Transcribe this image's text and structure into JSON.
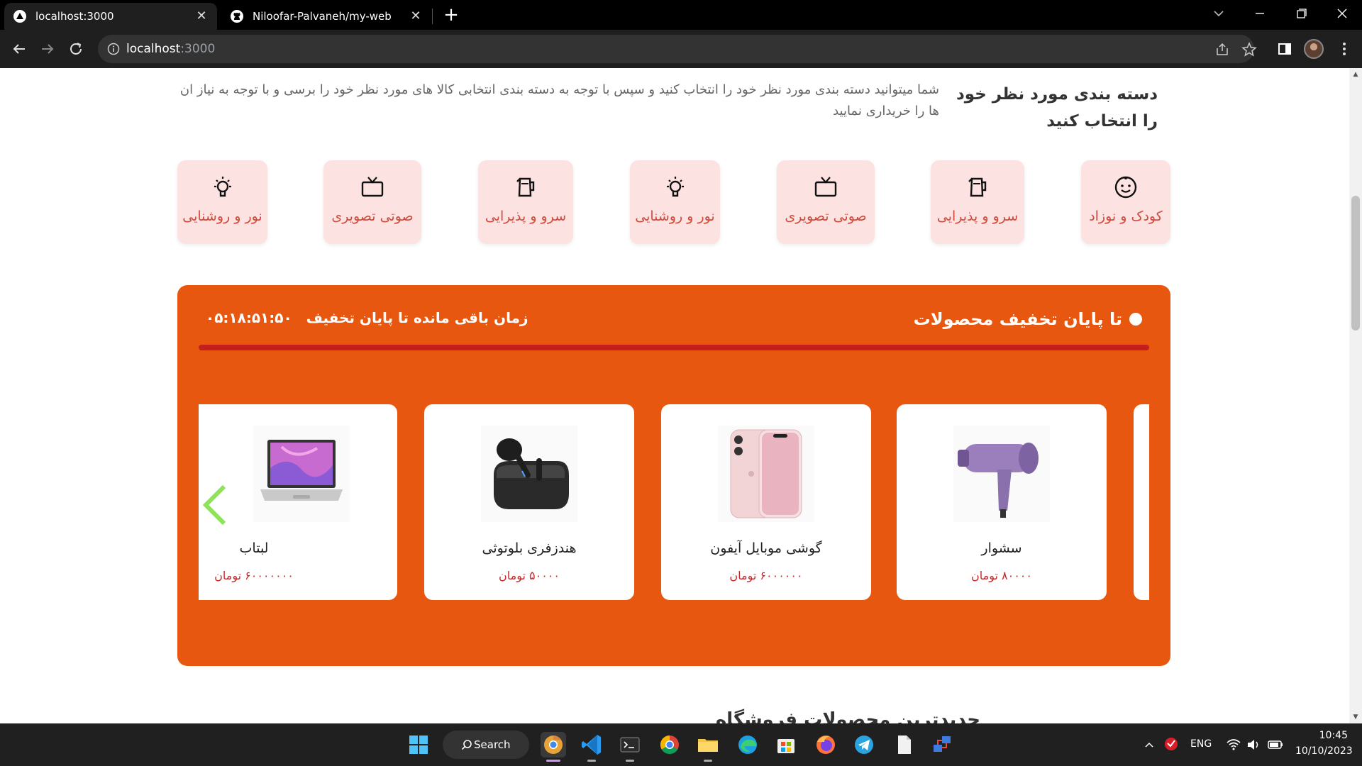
{
  "browser": {
    "tabs": [
      {
        "title": "localhost:3000",
        "active": true
      },
      {
        "title": "Niloofar-Palvaneh/my-web",
        "active": false
      }
    ],
    "url_host": "localhost",
    "url_port": ":3000"
  },
  "categories": {
    "title": "دسته بندی مورد نظر خود را انتخاب کنید",
    "description": "شما میتوانید دسته بندی مورد نظر خود را انتخاب کنید و سپس با توجه به دسته بندی انتخابی کالا های مورد نظر خود را برسی و با توجه به نیاز ان ها را خریداری نمایید",
    "items": [
      {
        "label": "کودک و نوزاد",
        "icon": "baby-face-icon"
      },
      {
        "label": "سرو و پذیرایی",
        "icon": "kettle-icon"
      },
      {
        "label": "صوتی تصویری",
        "icon": "tv-icon"
      },
      {
        "label": "نور و روشنایی",
        "icon": "light-bulb-icon"
      },
      {
        "label": "سرو و پذیرایی",
        "icon": "kettle-icon"
      },
      {
        "label": "صوتی تصویری",
        "icon": "tv-icon"
      },
      {
        "label": "نور و روشنایی",
        "icon": "light-bulb-icon"
      }
    ]
  },
  "deal": {
    "title": "تا پایان تخفیف محصولات",
    "timer_label": "زمان باقی مانده تا پایان تخفیف",
    "timer_value": "۰۵:۱۸:۵۱:۵۰",
    "bg_color": "#e8570f",
    "bar_color": "#c41f1a",
    "products": [
      {
        "name": "سشوار",
        "price": "۸۰۰۰۰ تومان",
        "image": "hair-dryer-image"
      },
      {
        "name": "گوشی موبایل آیفون",
        "price": "۶۰۰۰۰۰۰ تومان",
        "image": "iphone-image"
      },
      {
        "name": "هندزفری بلوتوثی",
        "price": "۵۰۰۰۰ تومان",
        "image": "bluetooth-earbuds-image"
      },
      {
        "name": "لبتاب",
        "price": "۶۰۰۰۰۰۰۰ تومان",
        "image": "laptop-image"
      }
    ]
  },
  "next_section": {
    "title": "جدیدترین محصولات فروشگاه"
  },
  "taskbar": {
    "search_label": "Search",
    "language": "ENG",
    "time": "10:45",
    "date": "10/10/2023"
  }
}
